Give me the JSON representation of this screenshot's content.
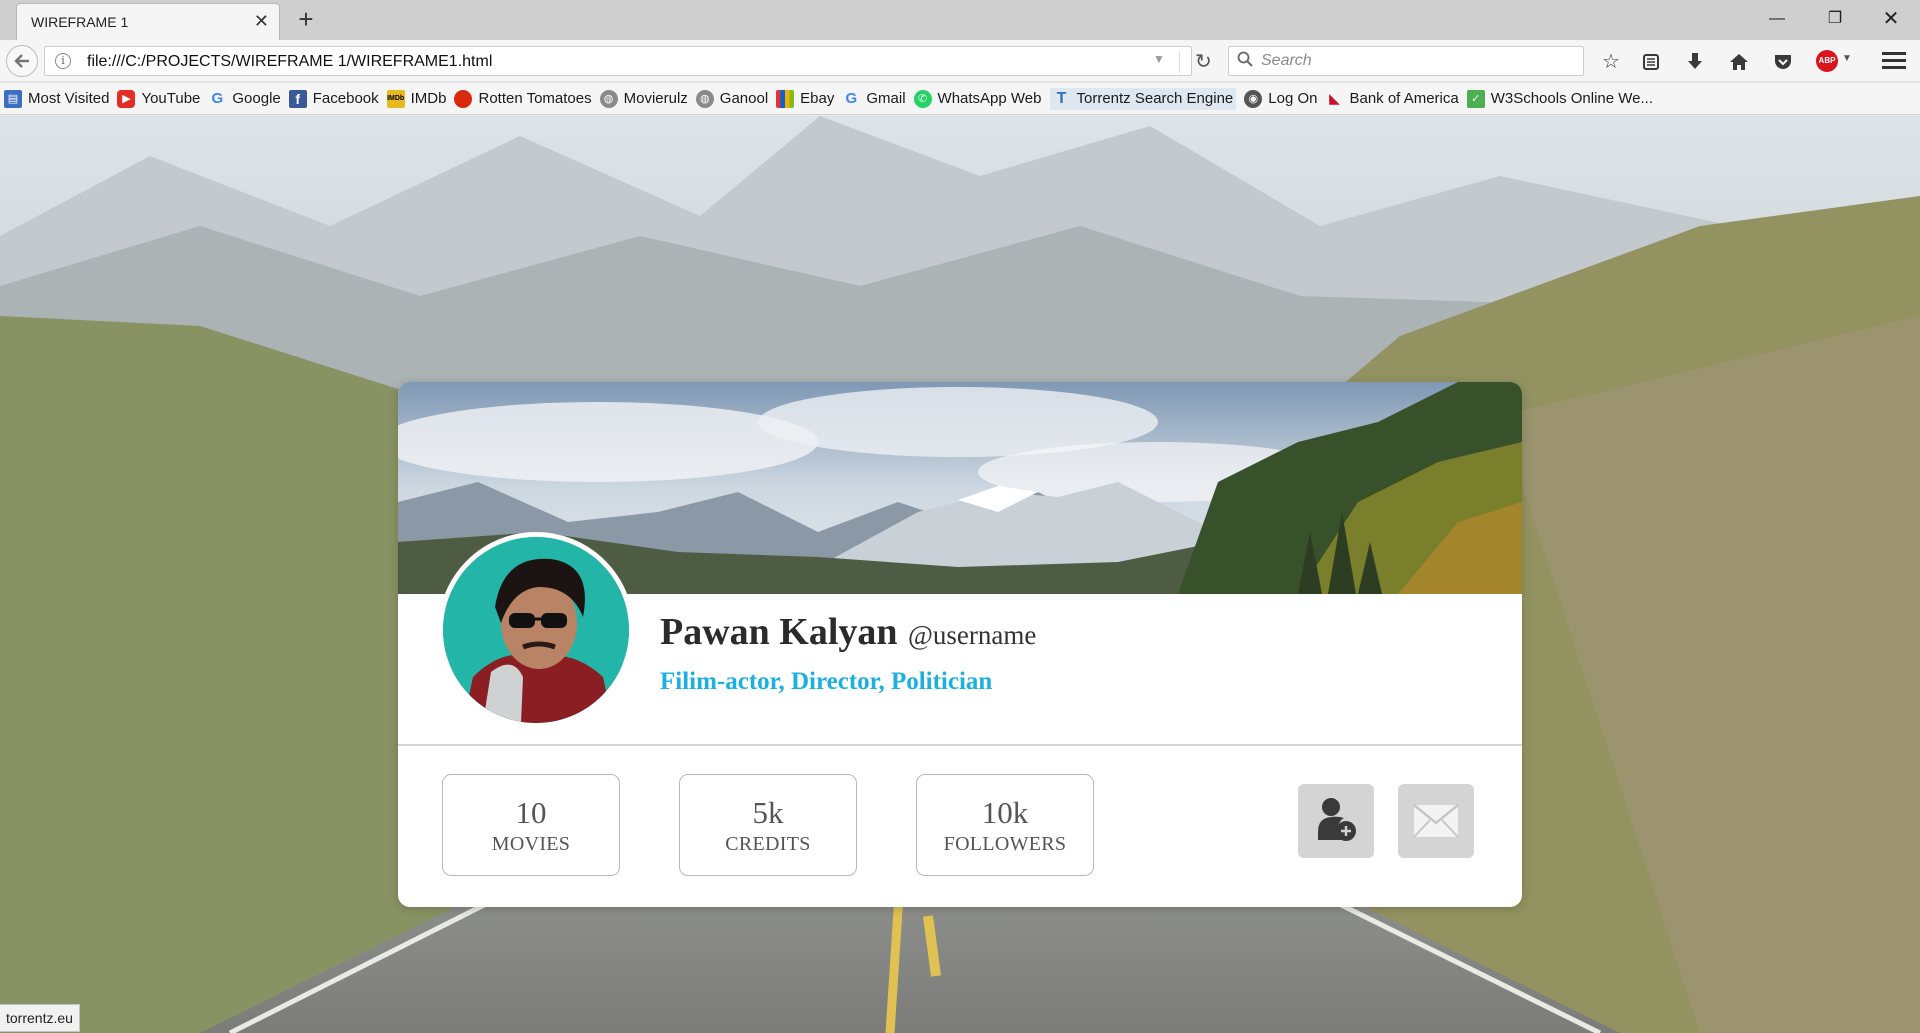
{
  "browser": {
    "tab_title": "WIREFRAME 1",
    "url": "file:///C:/PROJECTS/WIREFRAME 1/WIREFRAME1.html",
    "search_placeholder": "Search",
    "status_text": "torrentz.eu",
    "toolbar_icons": [
      "bookmark-star-icon",
      "reading-list-icon",
      "download-icon",
      "home-icon",
      "pocket-icon",
      "adblock-icon",
      "hamburger-menu-icon"
    ],
    "window_controls": [
      "minimize",
      "restore",
      "close"
    ]
  },
  "bookmarks": [
    {
      "label": "Most Visited",
      "icon": "most-visited-icon",
      "color": "#3c6fc2"
    },
    {
      "label": "YouTube",
      "icon": "youtube-icon",
      "color": "#e52d27"
    },
    {
      "label": "Google",
      "icon": "google-icon",
      "color": "#4285f4"
    },
    {
      "label": "Facebook",
      "icon": "facebook-icon",
      "color": "#3b5998"
    },
    {
      "label": "IMDb",
      "icon": "imdb-icon",
      "color": "#e6b91e"
    },
    {
      "label": "Rotten Tomatoes",
      "icon": "tomato-icon",
      "color": "#d9290d"
    },
    {
      "label": "Movierulz",
      "icon": "globe-icon",
      "color": "#8a8a8a"
    },
    {
      "label": "Ganool",
      "icon": "globe-icon",
      "color": "#8a8a8a"
    },
    {
      "label": "Ebay",
      "icon": "ebay-icon",
      "color": "#e53238"
    },
    {
      "label": "Gmail",
      "icon": "google-icon",
      "color": "#4285f4"
    },
    {
      "label": "WhatsApp Web",
      "icon": "whatsapp-icon",
      "color": "#25d366"
    },
    {
      "label": "Torrentz Search Engine",
      "icon": "torrentz-icon",
      "color": "#2f6fb7"
    },
    {
      "label": "Log On",
      "icon": "logon-icon",
      "color": "#555555"
    },
    {
      "label": "Bank of America",
      "icon": "bank-of-america-icon",
      "color": "#c8102e"
    },
    {
      "label": "W3Schools Online We...",
      "icon": "w3schools-icon",
      "color": "#4caf50"
    }
  ],
  "profile": {
    "name": "Pawan Kalyan",
    "username": "@username",
    "role": "Filim-actor, Director, Politician",
    "role_color": "#1bb0e0",
    "stats": [
      {
        "value": "10",
        "label": "MOVIES"
      },
      {
        "value": "5k",
        "label": "CREDITS"
      },
      {
        "value": "10k",
        "label": "FOLLOWERS"
      }
    ],
    "actions": [
      {
        "name": "follow-button",
        "icon": "add-user-icon"
      },
      {
        "name": "message-button",
        "icon": "envelope-icon"
      }
    ]
  }
}
